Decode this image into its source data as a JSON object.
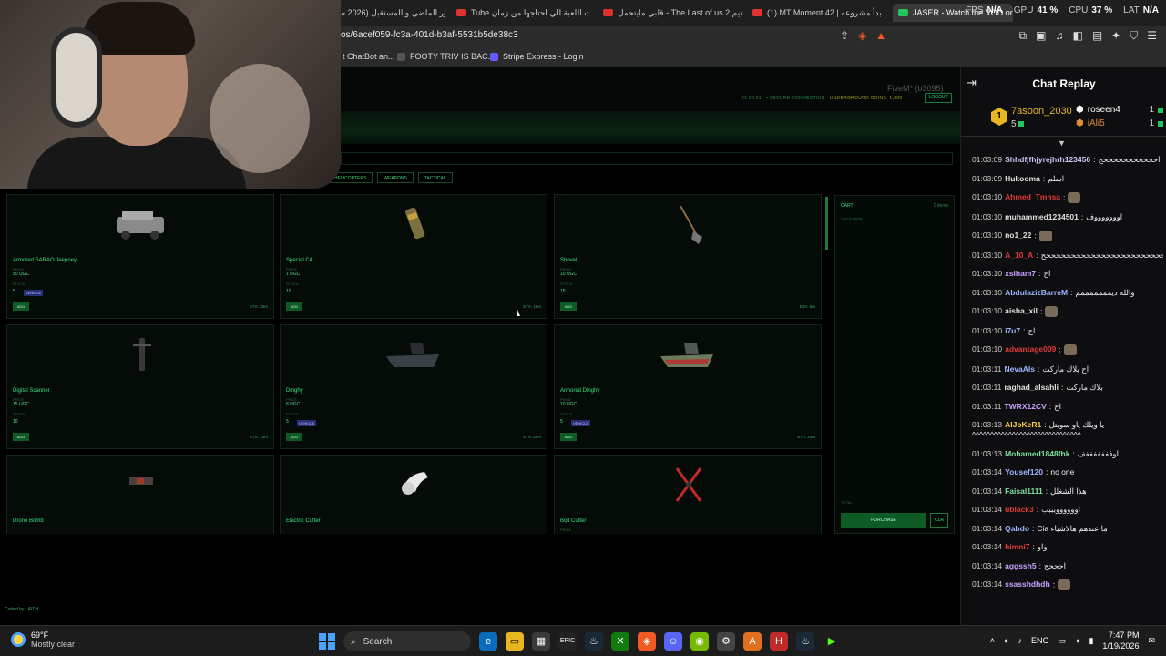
{
  "browser": {
    "tabs": [
      {
        "label": "باور الماضي و المستقبل (2026 سنة"
      },
      {
        "label": "Tube لقيت اللعبة الي احتاجها من زمان"
      },
      {
        "label": "قلبي مايتحمل - The Last of us 2 تختيم"
      },
      {
        "label": "(1) MT Moment 42 | بدأ مشروعه"
      },
      {
        "label": "JASER - Watch the VOD on"
      }
    ],
    "hud": {
      "fps_label": "FPS",
      "fps": "N/A",
      "gpu_label": "GPU",
      "gpu": "41 %",
      "cpu_label": "CPU",
      "cpu": "37 %",
      "lat_label": "LAT",
      "lat": "N/A"
    },
    "url": "os/6acef059-fc3a-401d-b3af-5531b5de38c3",
    "bookmarks": [
      "t ChatBot an...",
      "FOOTY TRIV IS BAC...",
      "Stripe Express - Login"
    ]
  },
  "game": {
    "server_tag": "FiveM* (b3095)",
    "clock": "21:06:01",
    "secure": "• SECURE CONNECTION",
    "coins_label": "UNDERGROUND COINS: 1,000",
    "logout": "LOGOUT",
    "categories": [
      "HELICOPTERS",
      "WEAPONS",
      "TACTICAL"
    ],
    "price_label": "PRICE",
    "stock_label": "STOCK",
    "add_label": "ADD",
    "items": [
      {
        "name": "Armored SARAO Jeepney",
        "price": "50 UGC",
        "stock": "5",
        "tag": "VEHICLE",
        "eta": "ETA: 30m"
      },
      {
        "name": "Special C4",
        "price": "1 UGC",
        "stock": "10",
        "tag": "",
        "eta": "ETA: 10m"
      },
      {
        "name": "Shovel",
        "price": "10 UGC",
        "stock": "15",
        "tag": "",
        "eta": "ETA: 5m"
      },
      {
        "name": "Digital Scanner",
        "price": "15 UGC",
        "stock": "10",
        "tag": "",
        "eta": "ETA: 15m"
      },
      {
        "name": "Dinghy",
        "price": "8 UGC",
        "stock": "5",
        "tag": "VEHICLE",
        "eta": "ETA: 20m"
      },
      {
        "name": "Armored Dinghy",
        "price": "10 UGC",
        "stock": "5",
        "tag": "VEHICLE",
        "eta": "ETA: 20m"
      },
      {
        "name": "Drone Bomb",
        "price": "",
        "stock": "",
        "tag": "",
        "eta": ""
      },
      {
        "name": "Electric Cutter",
        "price": "",
        "stock": "",
        "tag": "",
        "eta": ""
      },
      {
        "name": "Bolt Cutter",
        "price": "",
        "stock": "",
        "tag": "",
        "eta": ""
      }
    ],
    "cart": {
      "title": "CART",
      "count": "0 items",
      "empty": "Cart is empty",
      "total_label": "TOTAL",
      "purchase": "PURCHASE",
      "clear": "CLR"
    },
    "credit": "Coded by LAITH"
  },
  "chat": {
    "title": "Chat Replay",
    "leaders": [
      {
        "rank": "1",
        "name": "7asoon_2030",
        "count": "5"
      },
      {
        "name": "roseen4",
        "count": "1"
      },
      {
        "name": "iAli5",
        "count": "1"
      }
    ],
    "messages": [
      {
        "time": "01:03:09",
        "user": "Shhdfjfhjyrejhrh123456",
        "color": "#c9c9ff",
        "text": "احححححححححححح",
        "wrap": true
      },
      {
        "time": "01:03:09",
        "user": "Hukooma",
        "color": "#e0e0e0",
        "text": "اسلم"
      },
      {
        "time": "01:03:10",
        "user": "Ahmed_Tmnsa",
        "color": "#e03a3a",
        "text": "",
        "emote": true
      },
      {
        "time": "01:03:10",
        "user": "muhammed1234501",
        "color": "#e0e0e0",
        "text": "اوووووووف"
      },
      {
        "time": "01:03:10",
        "user": "no1_22",
        "color": "#e0e0e0",
        "text": "",
        "emote": true
      },
      {
        "time": "01:03:10",
        "user": "A_10_A",
        "color": "#e03a3a",
        "text": "احححححححححححححححححححححححححححححح",
        "wrap": true
      },
      {
        "time": "01:03:10",
        "user": "xsiham7",
        "color": "#c9a0ff",
        "text": "اح"
      },
      {
        "time": "01:03:10",
        "user": "AbdulazizBarreM",
        "color": "#9ab8ff",
        "text": "والله ديمممممممم"
      },
      {
        "time": "01:03:10",
        "user": "aisha_xil",
        "color": "#e0e0e0",
        "text": "",
        "emote": true
      },
      {
        "time": "01:03:10",
        "user": "i7u7",
        "color": "#9ab8ff",
        "text": "اح"
      },
      {
        "time": "01:03:10",
        "user": "advantage009",
        "color": "#e03a3a",
        "text": "",
        "emote": true
      },
      {
        "time": "01:03:11",
        "user": "NevaAls",
        "color": "#9ab8ff",
        "text": "اح بلاك ماركت"
      },
      {
        "time": "01:03:11",
        "user": "raghad_alsahli",
        "color": "#e0e0e0",
        "text": "بلاك ماركت"
      },
      {
        "time": "01:03:11",
        "user": "TWRX12CV",
        "color": "#c9a0ff",
        "text": "اح"
      },
      {
        "time": "01:03:13",
        "user": "AlJoKeR1",
        "color": "#ffd34a",
        "text": "يا ويلك ياو سويتل ^^^^^^^^^^^^^^^^^^^^^^^^^^^^^^",
        "wrap": true
      },
      {
        "time": "01:03:13",
        "user": "Mohamed1848fhk",
        "color": "#7ee0a0",
        "text": "اوفففففففف"
      },
      {
        "time": "01:03:14",
        "user": "Yousef120",
        "color": "#9ab8ff",
        "text": "no one"
      },
      {
        "time": "01:03:14",
        "user": "Faisal1111",
        "color": "#7ee0a0",
        "text": "هذا الشغلل"
      },
      {
        "time": "01:03:14",
        "user": "ublack3",
        "color": "#e03a3a",
        "text": "اووووووبببب"
      },
      {
        "time": "01:03:14",
        "user": "Qabdo",
        "color": "#9ab8ff",
        "text": "Cia ما عندهم هالاشياء"
      },
      {
        "time": "01:03:14",
        "user": "himni7",
        "color": "#e03a3a",
        "text": "واو"
      },
      {
        "time": "01:03:14",
        "user": "aggssh5",
        "color": "#c9a0ff",
        "text": "احححح"
      },
      {
        "time": "01:03:14",
        "user": "ssasshdhdh",
        "color": "#c9a0ff",
        "text": "",
        "emote": true
      }
    ]
  },
  "taskbar": {
    "temp": "69°F",
    "condition": "Mostly clear",
    "search": "Search",
    "lang": "ENG",
    "time": "7:47 PM",
    "date": "1/19/2026"
  }
}
